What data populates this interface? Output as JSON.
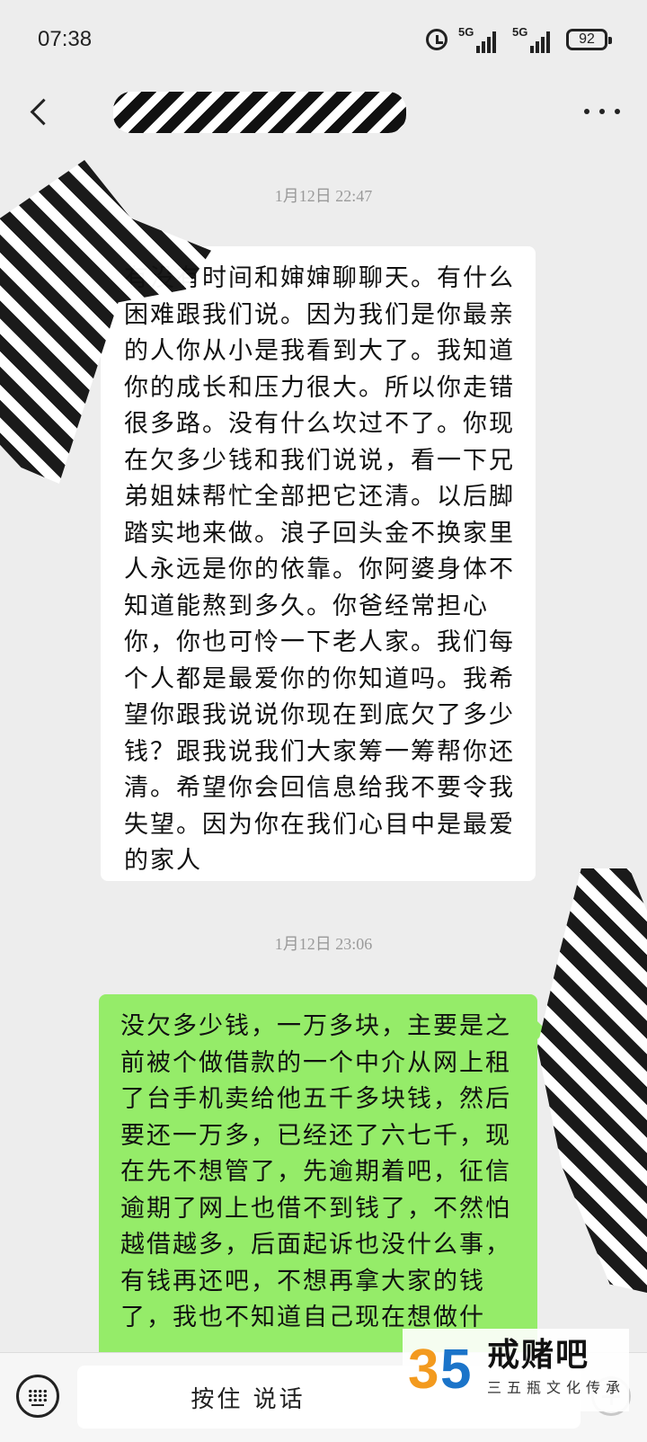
{
  "status_bar": {
    "time": "07:38",
    "network_1": "5G",
    "network_2": "5G",
    "battery": "92",
    "icons": [
      "alarm-icon",
      "signal-icon",
      "signal-icon",
      "battery-icon"
    ]
  },
  "nav": {
    "back_icon": "chevron-left-icon",
    "contact_name": "",
    "more_icon": "more-dots-icon"
  },
  "chat": {
    "messages": [
      {
        "timestamp": "1月12日 22:47",
        "direction": "incoming",
        "text": "有没有时间和婶婶聊聊天。有什么困难跟我们说。因为我们是你最亲的人你从小是我看到大了。我知道你的成长和压力很大。所以你走错很多路。没有什么坎过不了。你现在欠多少钱和我们说说，看一下兄弟姐妹帮忙全部把它还清。以后脚踏实地来做。浪子回头金不换家里人永远是你的依靠。你阿婆身体不知道能熬到多久。你爸经常担心你，你也可怜一下老人家。我们每个人都是最爱你的你知道吗。我希望你跟我说说你现在到底欠了多少钱？跟我说我们大家筹一筹帮你还清。希望你会回信息给我不要令我失望。因为你在我们心目中是最爱的家人"
      },
      {
        "timestamp": "1月12日 23:06",
        "direction": "outgoing",
        "text": "没欠多少钱，一万多块，主要是之前被个做借款的一个中介从网上租了台手机卖给他五千多块钱，然后要还一万多，已经还了六七千，现在先不想管了，先逾期着吧，征信逾期了网上也借不到钱了，不然怕越借越多，后面起诉也没什么事，有钱再还吧，不想再拿大家的钱了，我也不知道自己现在想做什"
      }
    ]
  },
  "input_bar": {
    "keyboard_icon": "keyboard-icon",
    "hold_to_talk": "按住 说话",
    "plus_icon": "plus-circle-icon"
  },
  "watermark": {
    "logo_text": "35",
    "title": "戒赌吧",
    "subtitle": "三五瓶文化传承"
  },
  "colors": {
    "background": "#ededed",
    "incoming_bubble": "#ffffff",
    "outgoing_bubble": "#95ec69",
    "timestamp": "#9a9a9a",
    "watermark_orange": "#f39a1e",
    "watermark_blue": "#1b74c9"
  }
}
